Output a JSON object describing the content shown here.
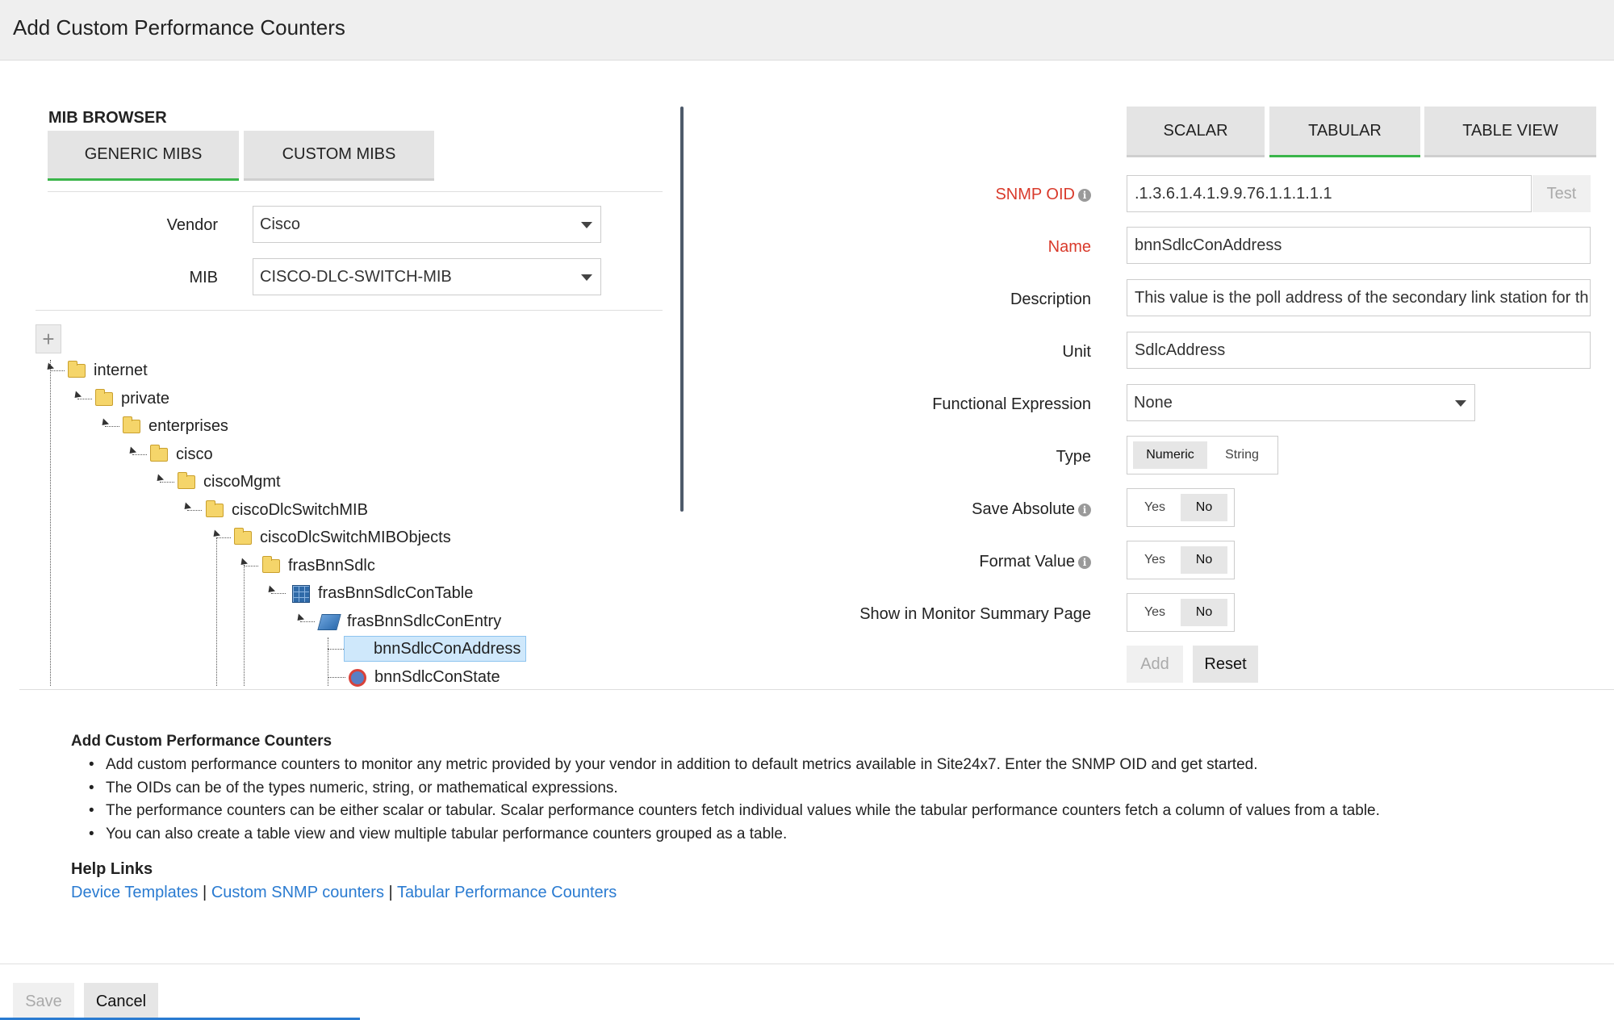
{
  "header": {
    "title": "Add Custom Performance Counters"
  },
  "mib_browser": {
    "title": "MIB BROWSER",
    "tabs": [
      {
        "label": "GENERIC MIBS",
        "active": true
      },
      {
        "label": "CUSTOM MIBS",
        "active": false
      }
    ],
    "vendor_label": "Vendor",
    "vendor_value": "Cisco",
    "mib_label": "MIB",
    "mib_value": "CISCO-DLC-SWITCH-MIB",
    "expand_button": "+",
    "tree": [
      {
        "label": "internet",
        "icon": "folder-icon"
      },
      {
        "label": "private",
        "icon": "folder-icon"
      },
      {
        "label": "enterprises",
        "icon": "folder-icon"
      },
      {
        "label": "cisco",
        "icon": "folder-icon"
      },
      {
        "label": "ciscoMgmt",
        "icon": "folder-icon"
      },
      {
        "label": "ciscoDlcSwitchMIB",
        "icon": "folder-icon"
      },
      {
        "label": "ciscoDlcSwitchMIBObjects",
        "icon": "folder-icon"
      },
      {
        "label": "frasBnnSdlc",
        "icon": "folder-icon"
      },
      {
        "label": "frasBnnSdlcConTable",
        "icon": "table-icon"
      },
      {
        "label": "frasBnnSdlcConEntry",
        "icon": "entry-icon"
      },
      {
        "label": "bnnSdlcConAddress",
        "icon": "leaf-icon",
        "selected": true
      },
      {
        "label": "bnnSdlcConState",
        "icon": "status-icon"
      }
    ]
  },
  "counter_tabs": [
    {
      "label": "SCALAR",
      "active": false
    },
    {
      "label": "TABULAR",
      "active": true
    },
    {
      "label": "TABLE VIEW",
      "active": false
    }
  ],
  "form": {
    "snmp_oid_label": "SNMP OID",
    "snmp_oid_value": ".1.3.6.1.4.1.9.9.76.1.1.1.1.1",
    "test_button": "Test",
    "name_label": "Name",
    "name_value": "bnnSdlcConAddress",
    "description_label": "Description",
    "description_value": "This value is the poll address of the secondary link station for th",
    "unit_label": "Unit",
    "unit_value": "SdlcAddress",
    "functional_expression_label": "Functional Expression",
    "functional_expression_value": "None",
    "type_label": "Type",
    "type_options": [
      "Numeric",
      "String"
    ],
    "type_selected": "Numeric",
    "save_absolute_label": "Save Absolute",
    "format_value_label": "Format Value",
    "show_summary_label": "Show in Monitor Summary Page",
    "yes_label": "Yes",
    "no_label": "No",
    "add_button": "Add",
    "reset_button": "Reset"
  },
  "help": {
    "title": "Add Custom Performance Counters",
    "bullets": [
      "Add custom performance counters to monitor any metric provided by your vendor in addition to default metrics available in Site24x7. Enter the SNMP OID and get started.",
      "The OIDs can be of the types numeric, string, or mathematical expressions.",
      "The performance counters can be either scalar or tabular. Scalar performance counters fetch individual values while the tabular performance counters fetch a column of values from a table.",
      "You can also create a table view and view multiple tabular performance counters grouped as a table."
    ],
    "links_title": "Help Links",
    "links": [
      "Device Templates",
      "Custom SNMP counters",
      "Tabular Performance Counters"
    ],
    "separator": "|"
  },
  "footer": {
    "save_button": "Save",
    "cancel_button": "Cancel"
  },
  "colors": {
    "accent_green": "#3ab54a",
    "label_red": "#d93a2b",
    "link_blue": "#2a7bd1"
  }
}
